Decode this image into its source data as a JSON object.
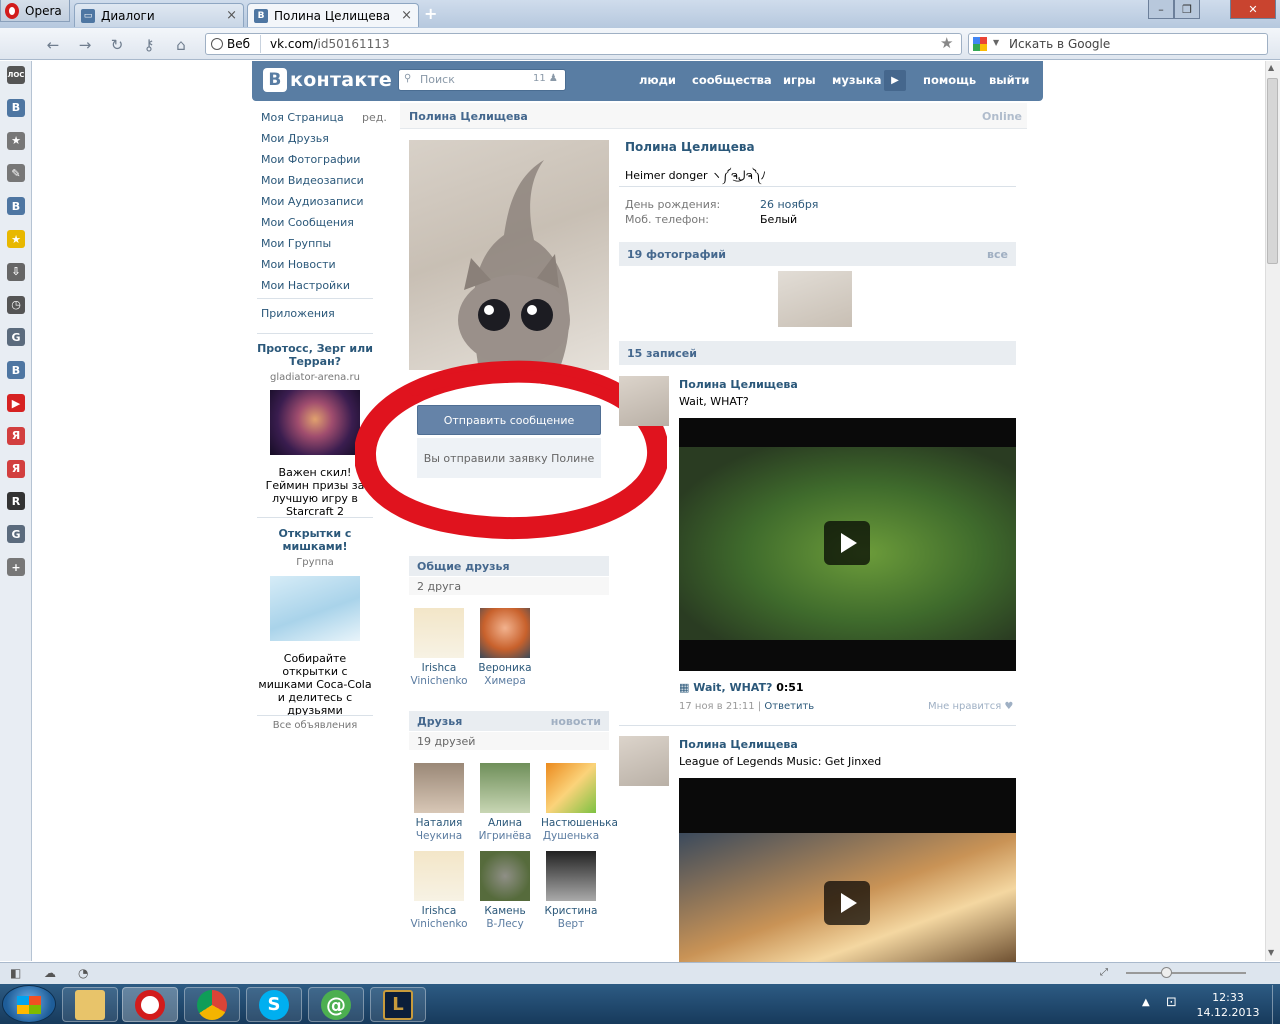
{
  "browser": {
    "app_name": "Opera",
    "tabs": [
      {
        "label": "Диалоги",
        "close": "×"
      },
      {
        "label": "Полина Целищева",
        "close": "×"
      }
    ],
    "new_tab": "+",
    "address": {
      "mode": "Веб",
      "host": "vk.com/",
      "path": "id50161113"
    },
    "search_placeholder": "Искать в Google",
    "window_controls": [
      "–",
      "❐",
      "✕"
    ]
  },
  "side_panel": {
    "items": [
      {
        "icon": "rss-icon",
        "label": "ЛОС"
      },
      {
        "icon": "vk-icon",
        "label": "В"
      },
      {
        "icon": "star-icon",
        "label": "★"
      },
      {
        "icon": "notes-icon",
        "label": "✎"
      },
      {
        "icon": "vk-icon",
        "label": "В"
      },
      {
        "icon": "bookmark-star-icon",
        "label": "★"
      },
      {
        "icon": "download-icon",
        "label": "⇩"
      },
      {
        "icon": "history-icon",
        "label": "◷"
      },
      {
        "icon": "google-icon",
        "label": "G"
      },
      {
        "icon": "vk-icon",
        "label": "В"
      },
      {
        "icon": "youtube-icon",
        "label": "▶"
      },
      {
        "icon": "yandex-icon",
        "label": "Я"
      },
      {
        "icon": "yandex-icon",
        "label": "Я"
      },
      {
        "icon": "rdr-icon",
        "label": "R"
      },
      {
        "icon": "google-icon",
        "label": "G"
      },
      {
        "icon": "add-icon",
        "label": "+"
      }
    ]
  },
  "vk": {
    "logo_box": "В",
    "logo_text": "контакте",
    "search_placeholder": "Поиск",
    "search_count": "11",
    "nav": [
      "люди",
      "сообщества",
      "игры",
      "музыка",
      "помощь",
      "выйти"
    ],
    "left_menu": [
      "Моя Страница",
      "Мои Друзья",
      "Мои Фотографии",
      "Мои Видеозаписи",
      "Мои Аудиозаписи",
      "Мои Сообщения",
      "Мои Группы",
      "Мои Новости",
      "Мои Настройки"
    ],
    "edit_label": "ред.",
    "apps": "Приложения",
    "ad1": {
      "title": "Протосс, Зерг или Терран?",
      "domain": "gladiator-arena.ru",
      "text": "Важен скил! Геймин призы за лучшую игру в Starcraft 2"
    },
    "ad2": {
      "title": "Открытки с мишками!",
      "sub": "Группа",
      "text": "Собирайте открытки с мишками Coca-Cola и делитесь с друзьями"
    },
    "all_ads": "Все объявления",
    "profile": {
      "header_name": "Полина Целищева",
      "online": "Online",
      "name": "Полина Целищева",
      "status": "Heimer donger ヽ༼ຈل͜ຈ༽ﾉ",
      "info": [
        {
          "key": "День рождения:",
          "value": "26 ноября"
        },
        {
          "key": "Моб. телефон:",
          "value": "Белый"
        }
      ],
      "send_message": "Отправить сообщение",
      "request_sent": "Вы отправили заявку Полине"
    },
    "common_friends": {
      "title": "Общие друзья",
      "count": "2 друга",
      "items": [
        {
          "first": "Irishca",
          "last": "Vinichenko"
        },
        {
          "first": "Вероника",
          "last": "Химера"
        }
      ]
    },
    "friends": {
      "title": "Друзья",
      "link": "новости",
      "count": "19 друзей",
      "items": [
        {
          "first": "Наталия",
          "last": "Чеукина"
        },
        {
          "first": "Алина",
          "last": "Игринёва"
        },
        {
          "first": "Настюшенька",
          "last": "Душенька"
        },
        {
          "first": "Irishca",
          "last": "Vinichenko"
        },
        {
          "first": "Камень",
          "last": "В-Лесу"
        },
        {
          "first": "Кристина",
          "last": "Верт"
        }
      ]
    },
    "photos": {
      "title": "19 фотографий",
      "link": "все"
    },
    "wall": {
      "title": "15 записей",
      "posts": [
        {
          "author": "Полина Целищева",
          "text": "Wait, WHAT?",
          "video_title": "Wait, WHAT?",
          "video_duration": "0:51",
          "date": "17 ноя в 21:11",
          "reply": "Ответить",
          "like": "Мне нравится ♥"
        },
        {
          "author": "Полина Целищева",
          "text": "League of Legends Music: Get Jinxed"
        }
      ]
    }
  },
  "taskbar": {
    "time": "12:33",
    "date": "14.12.2013"
  },
  "colors": {
    "vk_blue": "#597da3",
    "link": "#2b587a",
    "scribble": "#e0131e"
  }
}
